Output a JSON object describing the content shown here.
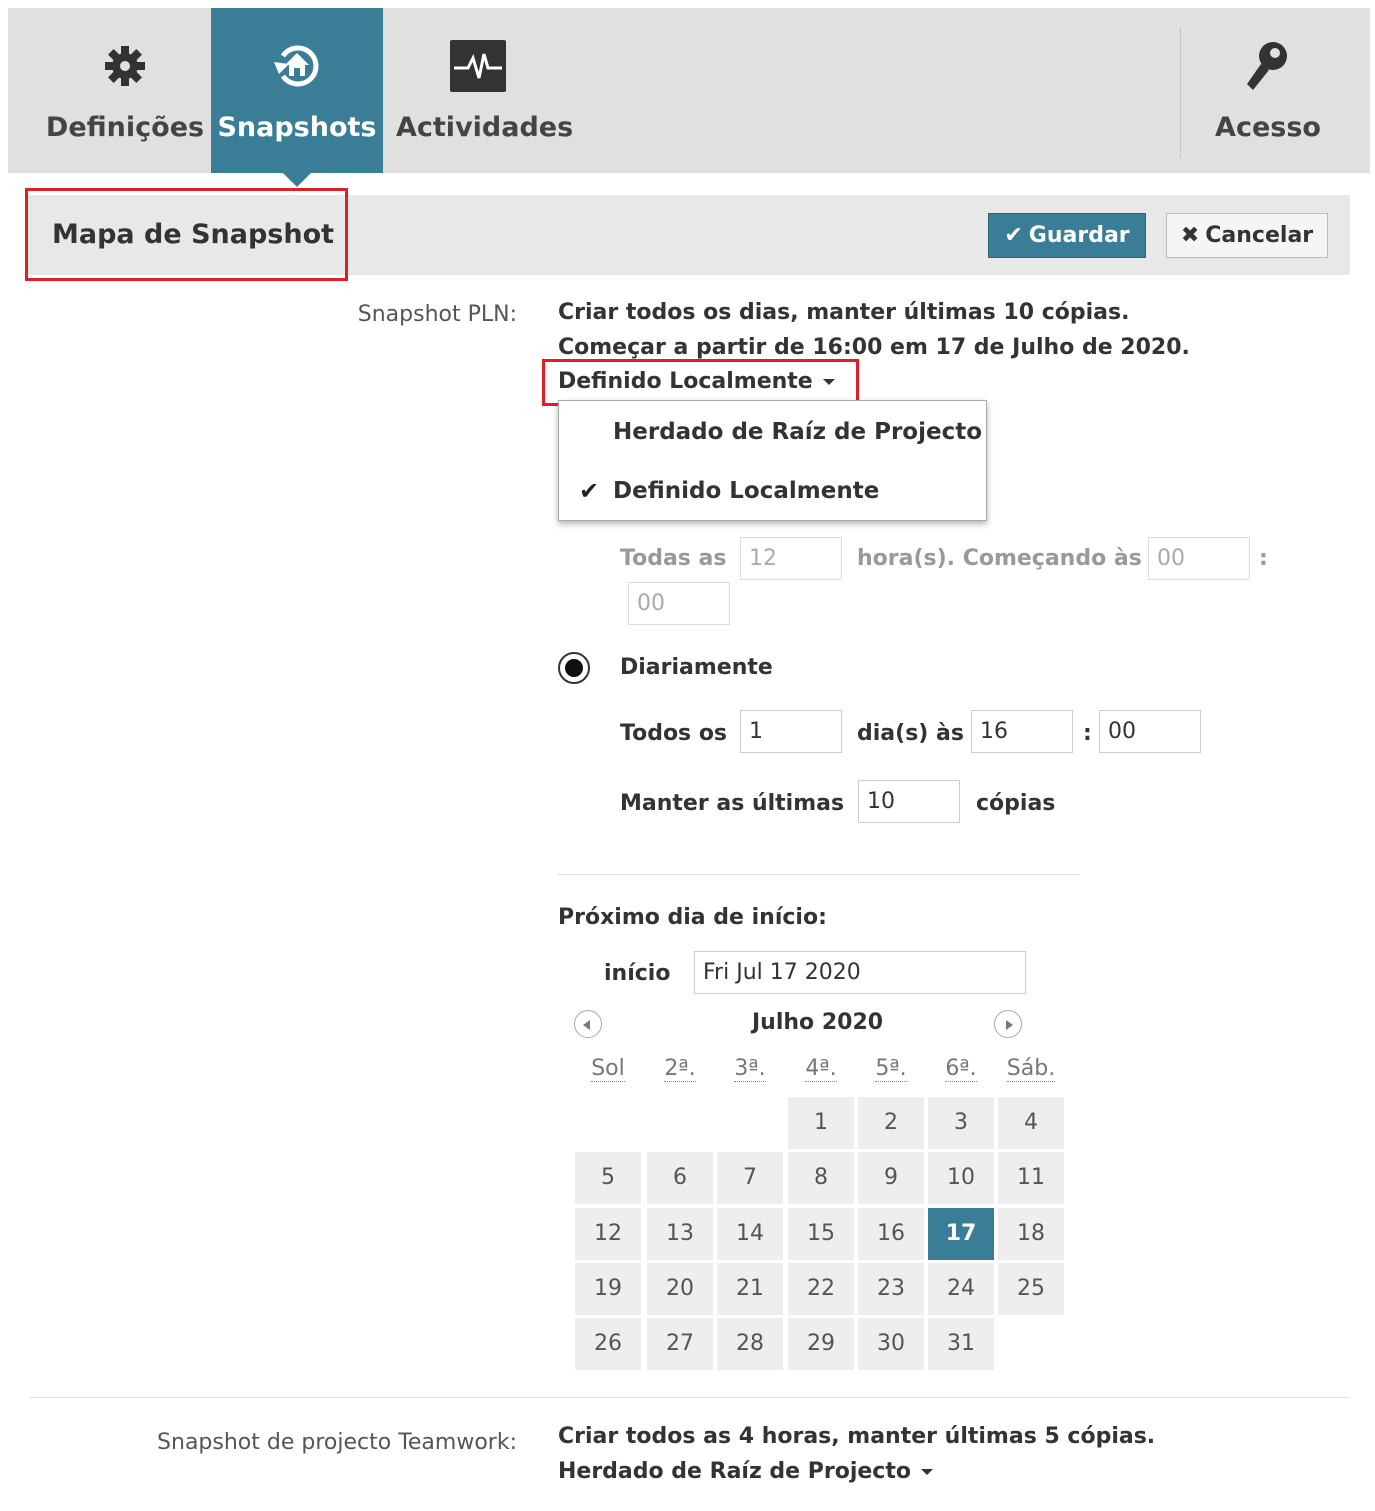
{
  "toolbar": {
    "tabs": [
      {
        "label": "Definições",
        "icon": "gear-icon"
      },
      {
        "label": "Snapshots",
        "icon": "snapshot-restore-icon"
      },
      {
        "label": "Actividades",
        "icon": "activity-pulse-icon"
      }
    ],
    "access": {
      "label": "Acesso",
      "icon": "key-icon"
    },
    "active_color": "#3a7d96"
  },
  "header": {
    "title": "Mapa de Snapshot",
    "save_label": "Guardar",
    "cancel_label": "Cancelar"
  },
  "pln": {
    "label": "Snapshot PLN:",
    "summary_line1": "Criar todos os dias, manter últimas 10 cópias.",
    "summary_line2": "Começar a partir de 16:00 em 17 de Julho de 2020.",
    "mode_selected": "Definido Localmente",
    "menu": {
      "items": [
        "Herdado de Raíz de Projecto",
        "Definido Localmente"
      ],
      "checked": "Definido Localmente"
    },
    "hourly": {
      "prefix": "Todas as",
      "hours": "12",
      "middle": "hora(s). Começando às",
      "start_hour": "00",
      "colon": ":",
      "start_min": "00"
    },
    "daily": {
      "label": "Diariamente",
      "prefix": "Todos os",
      "days": "1",
      "middle": "dia(s) às",
      "hour": "16",
      "colon": ":",
      "min": "00"
    },
    "keep": {
      "prefix": "Manter as últimas",
      "copies": "10",
      "suffix": "cópias"
    },
    "next_start": {
      "title": "Próximo dia de início:",
      "field_label": "início",
      "value": "Fri Jul 17 2020"
    },
    "calendar": {
      "month_label": "Julho  2020",
      "weekdays": [
        "Sol",
        "2ª.",
        "3ª.",
        "4ª.",
        "5ª.",
        "6ª.",
        "Sáb."
      ],
      "first_weekday_index": 3,
      "days_in_month": 31,
      "selected_day": 17
    }
  },
  "teamwork": {
    "label": "Snapshot de projecto Teamwork:",
    "summary": "Criar todos as 4 horas, manter últimas 5 cópias.",
    "mode": "Herdado de Raíz de Projecto"
  }
}
